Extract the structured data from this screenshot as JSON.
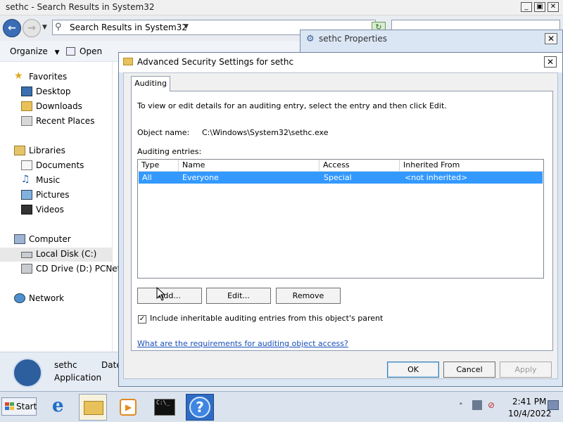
{
  "explorer": {
    "title": "sethc - Search Results in System32",
    "address": "Search Results in System32",
    "toolbar": {
      "organize": "Organize",
      "open": "Open"
    },
    "nav": {
      "favorites": "Favorites",
      "desktop": "Desktop",
      "downloads": "Downloads",
      "recent_places": "Recent Places",
      "libraries": "Libraries",
      "documents": "Documents",
      "music": "Music",
      "pictures": "Pictures",
      "videos": "Videos",
      "computer": "Computer",
      "local_disk": "Local Disk (C:)",
      "cd_drive": "CD Drive (D:) PCNet",
      "network": "Network"
    },
    "details": {
      "name": "sethc",
      "date_label": "Date",
      "type": "Application"
    }
  },
  "properties_window": {
    "title": "sethc Properties"
  },
  "advanced_dialog": {
    "title": "Advanced Security Settings for sethc",
    "tab": "Auditing",
    "instructions": "To view or edit details for an auditing entry, select the entry and then click Edit.",
    "object_name_label": "Object name:",
    "object_name_value": "C:\\Windows\\System32\\sethc.exe",
    "entries_label": "Auditing entries:",
    "columns": [
      "Type",
      "Name",
      "Access",
      "Inherited From"
    ],
    "entries": [
      {
        "type": "All",
        "name": "Everyone",
        "access": "Special",
        "inherited_from": "<not inherited>"
      }
    ],
    "buttons": {
      "add": "Add...",
      "edit": "Edit...",
      "remove": "Remove"
    },
    "include_inheritable": {
      "label": "Include inheritable auditing entries from this object's parent",
      "checked": true
    },
    "requirements_link": "What are the requirements for auditing object access?",
    "footer": {
      "ok": "OK",
      "cancel": "Cancel",
      "apply": "Apply"
    }
  },
  "taskbar": {
    "start": "Start",
    "clock_time": "2:41 PM",
    "clock_date": "10/4/2022",
    "cmd_prompt_text": "C:\\_"
  },
  "colors": {
    "selection": "#3399ff",
    "link": "#1a4fb8",
    "dialog_frame": "#dbe6f4"
  }
}
